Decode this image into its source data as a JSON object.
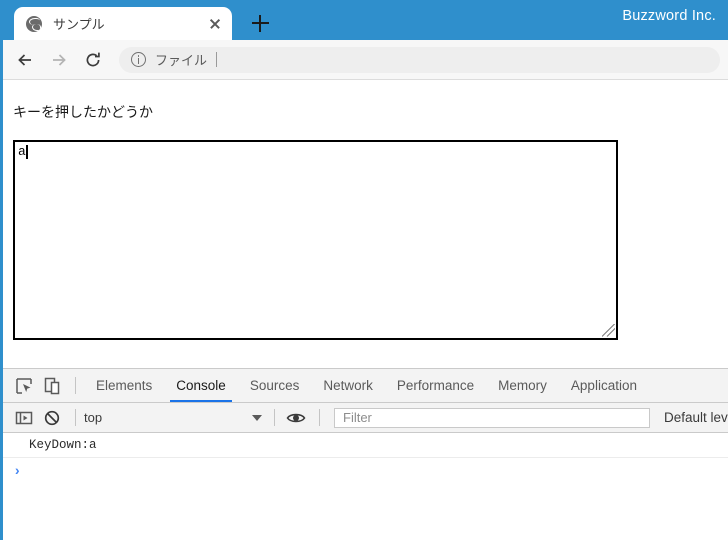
{
  "titlebar": {
    "tab": {
      "title": "サンプル",
      "favicon": "globe-icon",
      "close": "×"
    },
    "new_tab_label": "+",
    "brand": "Buzzword Inc.",
    "accent_color": "#2f8fcc"
  },
  "toolbar": {
    "back": "back-arrow-icon",
    "forward": "forward-arrow-icon",
    "reload": "reload-icon",
    "omnibox": {
      "security_icon": "info-circle-icon",
      "text": "ファイル"
    }
  },
  "page": {
    "heading": "キーを押したかどうか",
    "textarea_value": "a"
  },
  "devtools": {
    "icons": {
      "inspect": "inspect-cursor-icon",
      "device": "device-toolbar-icon",
      "sidebar": "console-sidebar-icon",
      "clear": "clear-console-icon",
      "eye": "eye-icon"
    },
    "tabs": [
      {
        "label": "Elements",
        "active": false
      },
      {
        "label": "Console",
        "active": true
      },
      {
        "label": "Sources",
        "active": false
      },
      {
        "label": "Network",
        "active": false
      },
      {
        "label": "Performance",
        "active": false
      },
      {
        "label": "Memory",
        "active": false
      },
      {
        "label": "Application",
        "active": false
      }
    ],
    "console_toolbar": {
      "context": "top",
      "filter_placeholder": "Filter",
      "levels": "Default levels"
    },
    "console_messages": [
      "KeyDown:a"
    ],
    "prompt": "›",
    "active_tab_underline_color": "#1a73e8"
  }
}
